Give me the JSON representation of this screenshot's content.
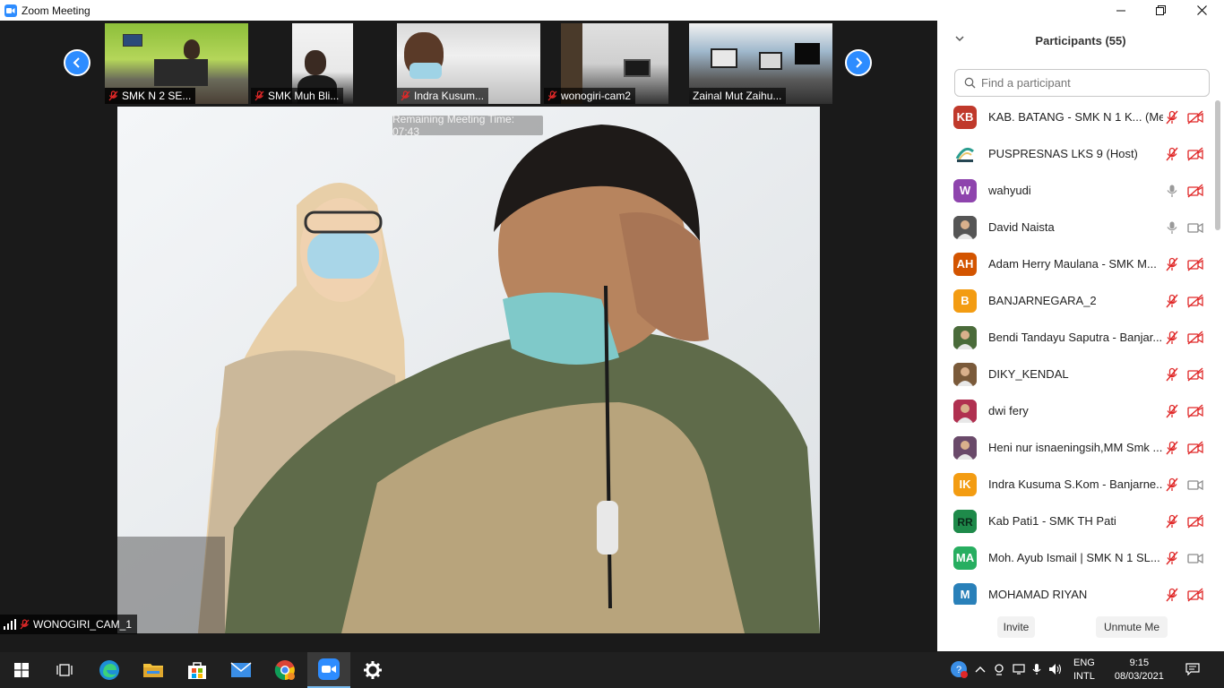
{
  "window": {
    "title": "Zoom Meeting"
  },
  "thumbnails": [
    {
      "name": "SMK N 2 SE..."
    },
    {
      "name": "SMK Muh Bli..."
    },
    {
      "name": "Indra Kusum..."
    },
    {
      "name": "wonogiri-cam2"
    },
    {
      "name": "Zainal Mut Zaihu..."
    }
  ],
  "main": {
    "remaining_time": "Remaining Meeting Time: 07:43",
    "active_speaker": "WONOGIRI_CAM_1"
  },
  "panel": {
    "title": "Participants (55)",
    "search_placeholder": "Find a participant",
    "participants": [
      {
        "initials": "KB",
        "color": "#c0392b",
        "name": "KAB. BATANG - SMK N 1 K... (Me)",
        "mic": "muted",
        "cam": "off"
      },
      {
        "initials": "",
        "color": "#ffffff",
        "name": "PUSPRESNAS LKS 9 (Host)",
        "mic": "muted",
        "cam": "off",
        "avatar": "logo"
      },
      {
        "initials": "W",
        "color": "#8e44ad",
        "name": "wahyudi",
        "mic": "on",
        "cam": "off"
      },
      {
        "initials": "",
        "color": "#555555",
        "name": "David Naista",
        "mic": "on",
        "cam": "on",
        "avatar": "photo"
      },
      {
        "initials": "AH",
        "color": "#d35400",
        "name": "Adam Herry Maulana - SMK M...",
        "mic": "muted",
        "cam": "off"
      },
      {
        "initials": "B",
        "color": "#f39c12",
        "name": "BANJARNEGARA_2",
        "mic": "muted",
        "cam": "off"
      },
      {
        "initials": "",
        "color": "#4a6b3a",
        "name": "Bendi Tandayu Saputra - Banjar...",
        "mic": "muted",
        "cam": "off",
        "avatar": "photo"
      },
      {
        "initials": "",
        "color": "#7a5a3a",
        "name": "DIKY_KENDAL",
        "mic": "muted",
        "cam": "off",
        "avatar": "photo"
      },
      {
        "initials": "",
        "color": "#b03050",
        "name": "dwi fery",
        "mic": "muted",
        "cam": "off",
        "avatar": "photo"
      },
      {
        "initials": "",
        "color": "#6a4a6a",
        "name": "Heni nur isnaeningsih,MM Smk ...",
        "mic": "muted",
        "cam": "off",
        "avatar": "photo"
      },
      {
        "initials": "IK",
        "color": "#f39c12",
        "name": "Indra Kusuma S.Kom - Banjarne...",
        "mic": "muted",
        "cam": "on"
      },
      {
        "initials": "",
        "color": "#1e8a4a",
        "name": "Kab Pati1 - SMK TH Pati",
        "mic": "muted",
        "cam": "off",
        "avatar": "logo-green"
      },
      {
        "initials": "MA",
        "color": "#27ae60",
        "name": "Moh. Ayub Ismail | SMK N 1 SL...",
        "mic": "muted",
        "cam": "on"
      },
      {
        "initials": "M",
        "color": "#2980b9",
        "name": "MOHAMAD RIYAN",
        "mic": "muted",
        "cam": "off"
      }
    ],
    "invite_label": "Invite",
    "unmute_label": "Unmute Me"
  },
  "taskbar": {
    "lang_top": "ENG",
    "lang_bottom": "INTL",
    "time": "9:15",
    "date": "08/03/2021"
  },
  "colors": {
    "zoom_blue": "#2d8cff",
    "muted_red": "#e02828"
  }
}
